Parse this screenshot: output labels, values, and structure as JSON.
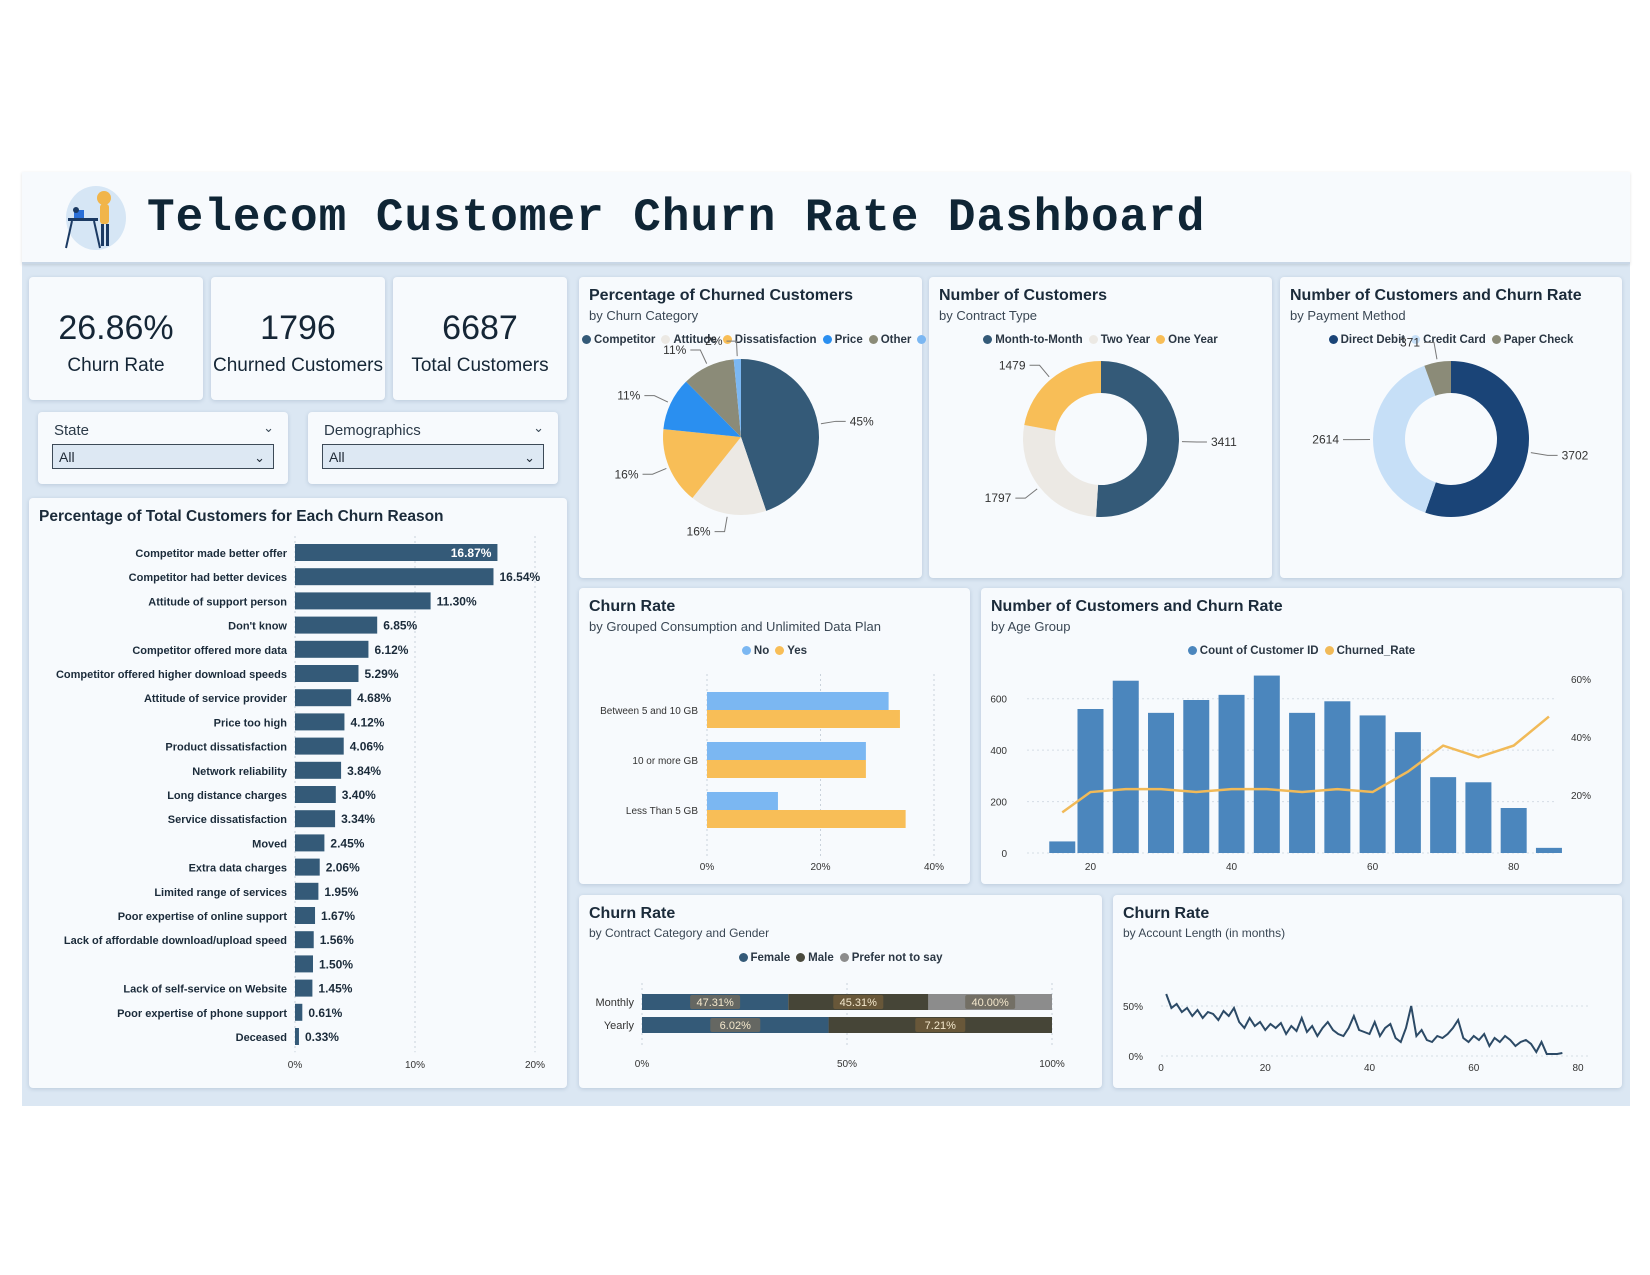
{
  "header": {
    "title": "Telecom Customer Churn Rate Dashboard",
    "logo_icon": "person-at-desk-illustration"
  },
  "kpis": [
    {
      "value": "26.86%",
      "label": "Churn Rate"
    },
    {
      "value": "1796",
      "label": "Churned Customers"
    },
    {
      "value": "6687",
      "label": "Total Customers"
    }
  ],
  "filters": {
    "state": {
      "label": "State",
      "value": "All"
    },
    "demographics": {
      "label": "Demographics",
      "value": "All"
    }
  },
  "colors": {
    "navy": "#345a78",
    "orange": "#f8be57",
    "light": "#e8e5e0",
    "blue": "#2a8ff0",
    "gray": "#8b8b78",
    "lightblue": "#7bb7f2",
    "bar_blue": "#4b86bd",
    "line_orange": "#f1ba58"
  },
  "charts": {
    "churn_reason": {
      "title": "Percentage of Total Customers for Each Churn Reason",
      "chart_data": {
        "type": "bar",
        "categories": [
          "Competitor made better offer",
          "Competitor had better devices",
          "Attitude of support person",
          "Don't know",
          "Competitor offered more data",
          "Competitor offered higher download speeds",
          "Attitude of service provider",
          "Price too high",
          "Product dissatisfaction",
          "Network reliability",
          "Long distance charges",
          "Service dissatisfaction",
          "Moved",
          "Extra data charges",
          "Limited range of services",
          "Poor expertise of online support",
          "Lack of affordable download/upload speed",
          "",
          "Lack of self-service on Website",
          "Poor expertise of phone support",
          "Deceased"
        ],
        "values": [
          16.87,
          16.54,
          11.3,
          6.85,
          6.12,
          5.29,
          4.68,
          4.12,
          4.06,
          3.84,
          3.4,
          3.34,
          2.45,
          2.06,
          1.95,
          1.67,
          1.56,
          1.5,
          1.45,
          0.61,
          0.33
        ],
        "labels": [
          "16.87%",
          "16.54%",
          "11.30%",
          "6.85%",
          "6.12%",
          "5.29%",
          "4.68%",
          "4.12%",
          "4.06%",
          "3.84%",
          "3.40%",
          "3.34%",
          "2.45%",
          "2.06%",
          "1.95%",
          "1.67%",
          "1.56%",
          "1.50%",
          "1.45%",
          "0.61%",
          "0.33%"
        ],
        "xticks": [
          "0%",
          "10%",
          "20%"
        ],
        "xlim": [
          0,
          20
        ]
      }
    },
    "churn_category": {
      "title": "Percentage of Churned Customers",
      "subtitle": "by Churn Category",
      "legend": [
        "Competitor",
        "Attitude",
        "Dissatisfaction",
        "Price",
        "Other"
      ],
      "chart_data": {
        "type": "pie",
        "slices": [
          {
            "label": "45%",
            "value": 45,
            "color": "#345a78"
          },
          {
            "label": "16%",
            "value": 16,
            "color": "#ece9e4"
          },
          {
            "label": "16%",
            "value": 16,
            "color": "#f8be57"
          },
          {
            "label": "11%",
            "value": 11,
            "color": "#2a8ff0"
          },
          {
            "label": "11%",
            "value": 11,
            "color": "#8b8b78"
          },
          {
            "label": "2%",
            "value": 1.5,
            "color": "#7bb7f2"
          }
        ]
      }
    },
    "contract_type": {
      "title": "Number of Customers",
      "subtitle": "by Contract Type",
      "legend": [
        "Month-to-Month",
        "Two Year",
        "One Year"
      ],
      "chart_data": {
        "type": "pie",
        "slices": [
          {
            "label": "3411",
            "value": 3411,
            "color": "#345a78"
          },
          {
            "label": "1797",
            "value": 1797,
            "color": "#ece9e4"
          },
          {
            "label": "1479",
            "value": 1479,
            "color": "#f8be57"
          }
        ]
      }
    },
    "payment_method": {
      "title": "Number of Customers and Churn Rate",
      "subtitle": "by Payment Method",
      "legend": [
        "Direct Debit",
        "Credit Card",
        "Paper Check"
      ],
      "chart_data": {
        "type": "pie",
        "slices": [
          {
            "label": "3702",
            "value": 3702,
            "color": "#1a4477"
          },
          {
            "label": "2614",
            "value": 2614,
            "color": "#c6dff7"
          },
          {
            "label": "371",
            "value": 371,
            "color": "#8b8b78"
          }
        ]
      }
    },
    "consumption": {
      "title": "Churn Rate",
      "subtitle": "by Grouped Consumption and Unlimited Data Plan",
      "legend": [
        "No",
        "Yes"
      ],
      "chart_data": {
        "type": "bar",
        "categories": [
          "Between 5 and 10 GB",
          "10 or more GB",
          "Less Than 5 GB"
        ],
        "series": [
          {
            "name": "No",
            "values": [
              32,
              28,
              12.5
            ]
          },
          {
            "name": "Yes",
            "values": [
              34,
              28,
              35
            ]
          }
        ],
        "xticks": [
          "0%",
          "20%",
          "40%"
        ],
        "xlim": [
          0,
          40
        ]
      }
    },
    "age_group": {
      "title": "Number of Customers and Churn Rate",
      "subtitle": "by Age Group",
      "legend": [
        "Count of Customer ID",
        "Churned_Rate"
      ],
      "chart_data": {
        "type": "bar",
        "x": [
          16,
          20,
          25,
          30,
          35,
          40,
          45,
          50,
          55,
          60,
          65,
          70,
          75,
          80,
          85
        ],
        "series": [
          {
            "name": "Count of Customer ID",
            "values": [
              45,
              560,
              670,
              545,
              595,
              615,
              690,
              545,
              590,
              535,
              470,
              295,
              275,
              175,
              20
            ]
          },
          {
            "name": "Churned_Rate",
            "values": [
              14,
              21,
              22,
              22,
              21,
              22,
              22,
              21,
              22,
              21,
              28,
              37,
              33,
              37,
              47
            ]
          }
        ],
        "yticks_left": [
          "0",
          "200",
          "400",
          "600"
        ],
        "ylim_left": [
          0,
          700
        ],
        "yticks_right": [
          "20%",
          "40%",
          "60%"
        ],
        "ylim_right": [
          0,
          62
        ],
        "xticks": [
          "20",
          "40",
          "60",
          "80"
        ]
      }
    },
    "contract_gender": {
      "title": "Churn Rate",
      "subtitle": "by Contract Category and Gender",
      "legend": [
        "Female",
        "Male",
        "Prefer not to say"
      ],
      "chart_data": {
        "type": "bar",
        "categories": [
          "Monthly",
          "Yearly"
        ],
        "series": [
          {
            "name": "Female",
            "values": [
              47.31,
              6.02
            ]
          },
          {
            "name": "Male",
            "values": [
              45.31,
              7.21
            ]
          },
          {
            "name": "Prefer not to say",
            "values": [
              40.0,
              0
            ]
          }
        ],
        "stacked_labels": [
          [
            "47.31%",
            "45.31%",
            "40.00%"
          ],
          [
            "6.02%",
            "7.21%"
          ]
        ],
        "xticks": [
          "0%",
          "50%",
          "100%"
        ]
      }
    },
    "account_length": {
      "title": "Churn Rate",
      "subtitle": "by Account Length (in months)",
      "chart_data": {
        "type": "line",
        "x": [
          1,
          2,
          3,
          4,
          5,
          6,
          7,
          8,
          9,
          10,
          11,
          12,
          13,
          14,
          15,
          16,
          17,
          18,
          19,
          20,
          21,
          22,
          23,
          24,
          25,
          26,
          27,
          28,
          29,
          30,
          31,
          32,
          33,
          34,
          35,
          36,
          37,
          38,
          39,
          40,
          41,
          42,
          43,
          44,
          45,
          46,
          47,
          48,
          49,
          50,
          51,
          52,
          53,
          54,
          55,
          56,
          57,
          58,
          59,
          60,
          61,
          62,
          63,
          64,
          65,
          66,
          67,
          68,
          69,
          70,
          71,
          72,
          73,
          74,
          75,
          76,
          77
        ],
        "y": [
          62,
          48,
          52,
          44,
          48,
          40,
          46,
          38,
          44,
          42,
          36,
          45,
          40,
          48,
          34,
          28,
          38,
          30,
          34,
          26,
          32,
          28,
          33,
          22,
          30,
          25,
          38,
          24,
          30,
          20,
          28,
          34,
          26,
          22,
          20,
          28,
          40,
          26,
          24,
          22,
          34,
          20,
          28,
          32,
          18,
          14,
          28,
          50,
          20,
          26,
          16,
          14,
          20,
          18,
          22,
          28,
          36,
          18,
          14,
          20,
          16,
          22,
          10,
          18,
          14,
          20,
          16,
          10,
          14,
          16,
          12,
          4,
          14,
          2,
          2,
          2,
          3
        ],
        "yticks": [
          "0%",
          "50%"
        ],
        "ylim": [
          0,
          80
        ],
        "xticks": [
          "0",
          "20",
          "40",
          "60",
          "80"
        ],
        "xlim": [
          0,
          80
        ]
      }
    }
  }
}
